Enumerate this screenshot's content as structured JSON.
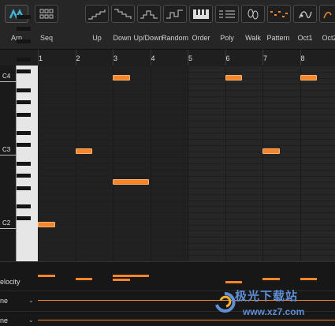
{
  "toolbar": {
    "labels": [
      "Arp",
      "Seq",
      "Up",
      "Down",
      "Up/Down",
      "Random",
      "Order",
      "Poly",
      "Walk",
      "Pattern",
      "Oct1",
      "Oct2"
    ],
    "icons": [
      "arp-icon",
      "seq-grid-icon",
      "up-steps-icon",
      "down-steps-icon",
      "updown-steps-icon",
      "random-steps-icon",
      "order-keyboard-icon",
      "poly-lines-icon",
      "walk-icon",
      "pattern-dots-icon",
      "octave1-icon",
      "octave2-icon"
    ],
    "accent": "#f5872a",
    "arp_accent": "#3fb4d6"
  },
  "ruler": {
    "bars": [
      "1",
      "2",
      "3",
      "4",
      "5",
      "6",
      "7",
      "8"
    ]
  },
  "keys": {
    "octaves": [
      "C4",
      "C3",
      "C2"
    ]
  },
  "notes": [
    {
      "pitch": "C2",
      "start": 1.0,
      "length": 0.5
    },
    {
      "pitch": "G2",
      "start": 3.0,
      "length": 1.0
    },
    {
      "pitch": "C3",
      "start": 2.0,
      "length": 0.5
    },
    {
      "pitch": "C4",
      "start": 3.0,
      "length": 0.5
    },
    {
      "pitch": "C4",
      "start": 6.0,
      "length": 0.5
    },
    {
      "pitch": "C3",
      "start": 7.0,
      "length": 0.5
    },
    {
      "pitch": "C4",
      "start": 8.0,
      "length": 0.5
    }
  ],
  "lanes": {
    "velocity_label": "elocity",
    "lane2_label": "ne",
    "lane3_label": "ne"
  },
  "watermark": {
    "text": "极光下载站",
    "url": "www.xz7.com"
  }
}
